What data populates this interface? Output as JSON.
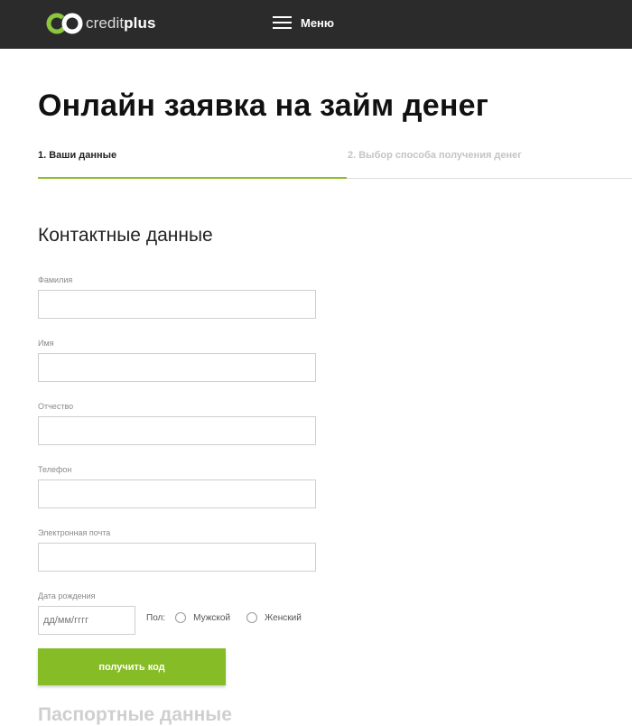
{
  "header": {
    "logo_text_part1": "credit",
    "logo_text_part2": "plus",
    "menu_label": "Меню"
  },
  "page": {
    "title": "Онлайн заявка на займ денег"
  },
  "steps": [
    {
      "label": "1. Ваши данные",
      "active": true
    },
    {
      "label": "2. Выбор способа получения денег",
      "active": false
    }
  ],
  "steps_progress": 0.52,
  "form": {
    "section_title": "Контактные данные",
    "fields": {
      "last_name": {
        "label": "Фамилия",
        "value": ""
      },
      "first_name": {
        "label": "Имя",
        "value": ""
      },
      "patronymic": {
        "label": "Отчество",
        "value": ""
      },
      "phone": {
        "label": "Телефон",
        "value": ""
      },
      "email": {
        "label": "Электронная почта",
        "value": ""
      },
      "birth_date": {
        "label": "Дата рождения",
        "placeholder": "дд/мм/гггг",
        "value": ""
      }
    },
    "gender": {
      "label": "Пол:",
      "options": [
        "Мужской",
        "Женский"
      ],
      "selected": null
    },
    "submit_label": "получить код",
    "next_section_title": "Паспортные данные"
  },
  "colors": {
    "header_bg": "#2b2b2b",
    "accent_green": "#86bc25",
    "logo_green": "#8cc63f"
  },
  "icons": [
    "creditplus-logo-icon",
    "menu-hamburger-icon"
  ]
}
